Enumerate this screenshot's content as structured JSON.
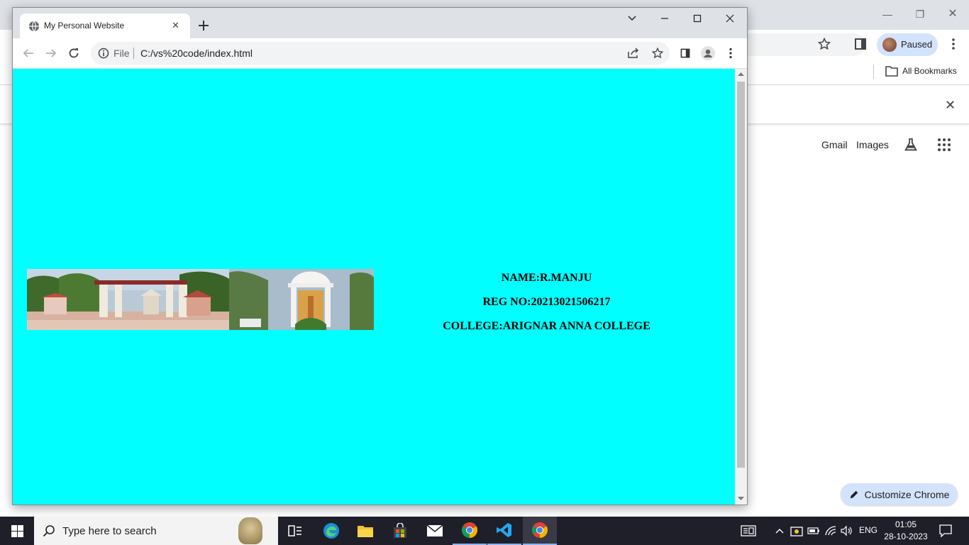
{
  "background_window": {
    "profile_label": "Paused",
    "bookmarks_label": "All Bookmarks",
    "links": [
      "Gmail",
      "Images"
    ],
    "customize_label": "Customize Chrome"
  },
  "browser": {
    "tab_title": "My Personal Website",
    "url_scheme": "File",
    "url": "C:/vs%20code/index.html"
  },
  "page": {
    "background_color": "#00ffff",
    "name_line": "NAME:R.MANJU",
    "reg_line": "REG NO:20213021506217",
    "college_line": "COLLEGE:ARIGNAR ANNA COLLEGE"
  },
  "taskbar": {
    "search_placeholder": "Type here to search",
    "language": "ENG",
    "time": "01:05",
    "date": "28-10-2023",
    "apps": [
      "task-view-icon",
      "edge-icon",
      "file-explorer-icon",
      "microsoft-store-icon",
      "mail-icon",
      "chrome-icon",
      "vscode-icon",
      "chrome-icon"
    ]
  }
}
